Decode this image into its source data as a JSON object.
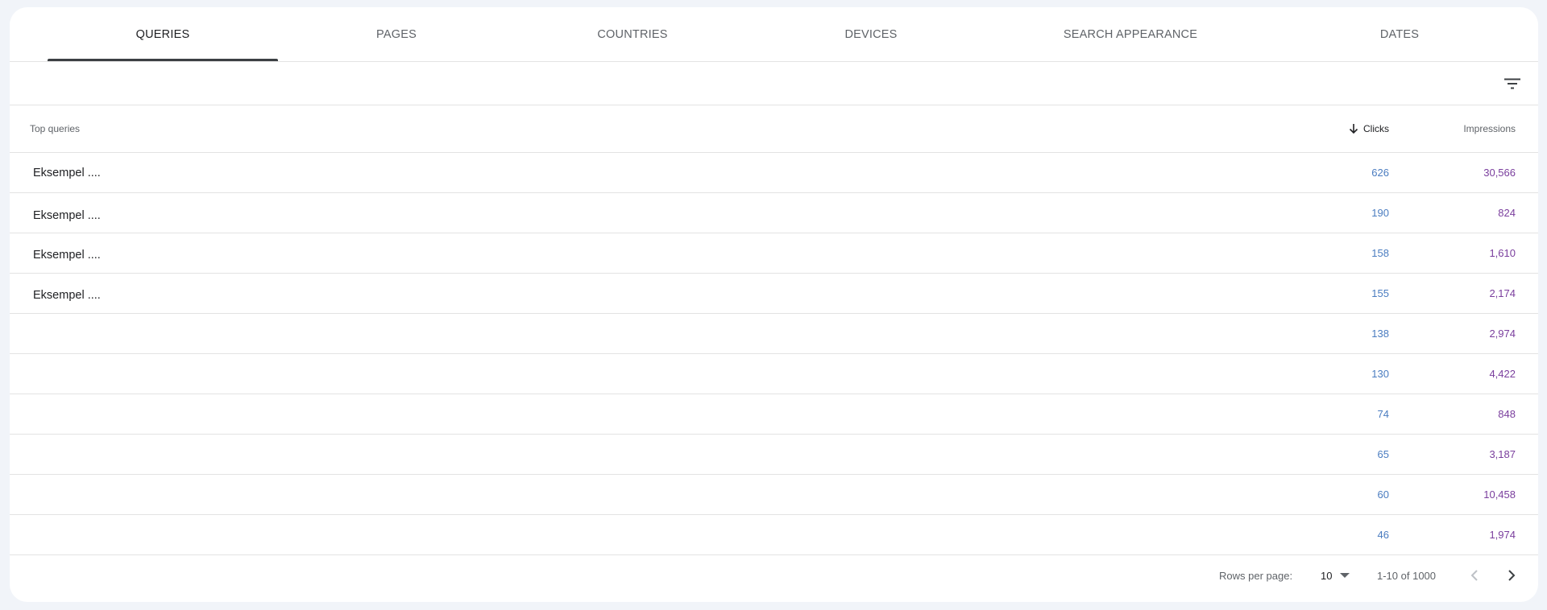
{
  "tabs": [
    {
      "label": "QUERIES",
      "active": true
    },
    {
      "label": "PAGES",
      "active": false
    },
    {
      "label": "COUNTRIES",
      "active": false
    },
    {
      "label": "DEVICES",
      "active": false
    },
    {
      "label": "SEARCH APPEARANCE",
      "active": false
    },
    {
      "label": "DATES",
      "active": false
    }
  ],
  "toolbar": {
    "filter_icon": "filter-list-icon"
  },
  "table": {
    "headers": {
      "query": "Top queries",
      "clicks": "Clicks",
      "impressions": "Impressions",
      "sort_icon": "arrow-downward-icon"
    },
    "rows": [
      {
        "query": "Eksempel ....",
        "clicks": "626",
        "impressions": "30,566"
      },
      {
        "query": "Eksempel ....",
        "clicks": "190",
        "impressions": "824"
      },
      {
        "query": "Eksempel ....",
        "clicks": "158",
        "impressions": "1,610"
      },
      {
        "query": "Eksempel ....",
        "clicks": "155",
        "impressions": "2,174"
      },
      {
        "query": "",
        "clicks": "138",
        "impressions": "2,974"
      },
      {
        "query": "",
        "clicks": "130",
        "impressions": "4,422"
      },
      {
        "query": "",
        "clicks": "74",
        "impressions": "848"
      },
      {
        "query": "",
        "clicks": "65",
        "impressions": "3,187"
      },
      {
        "query": "",
        "clicks": "60",
        "impressions": "10,458"
      },
      {
        "query": "",
        "clicks": "46",
        "impressions": "1,974"
      }
    ]
  },
  "pagination": {
    "rows_per_page_label": "Rows per page:",
    "rows_per_page_value": "10",
    "range_text": "1-10 of 1000",
    "prev_icon": "chevron-left-icon",
    "next_icon": "chevron-right-icon"
  },
  "colors": {
    "clicks": "#4a7cc0",
    "impressions": "#7a3e9d",
    "tab_indicator": "#3c4043",
    "background": "#f1f4f9"
  }
}
